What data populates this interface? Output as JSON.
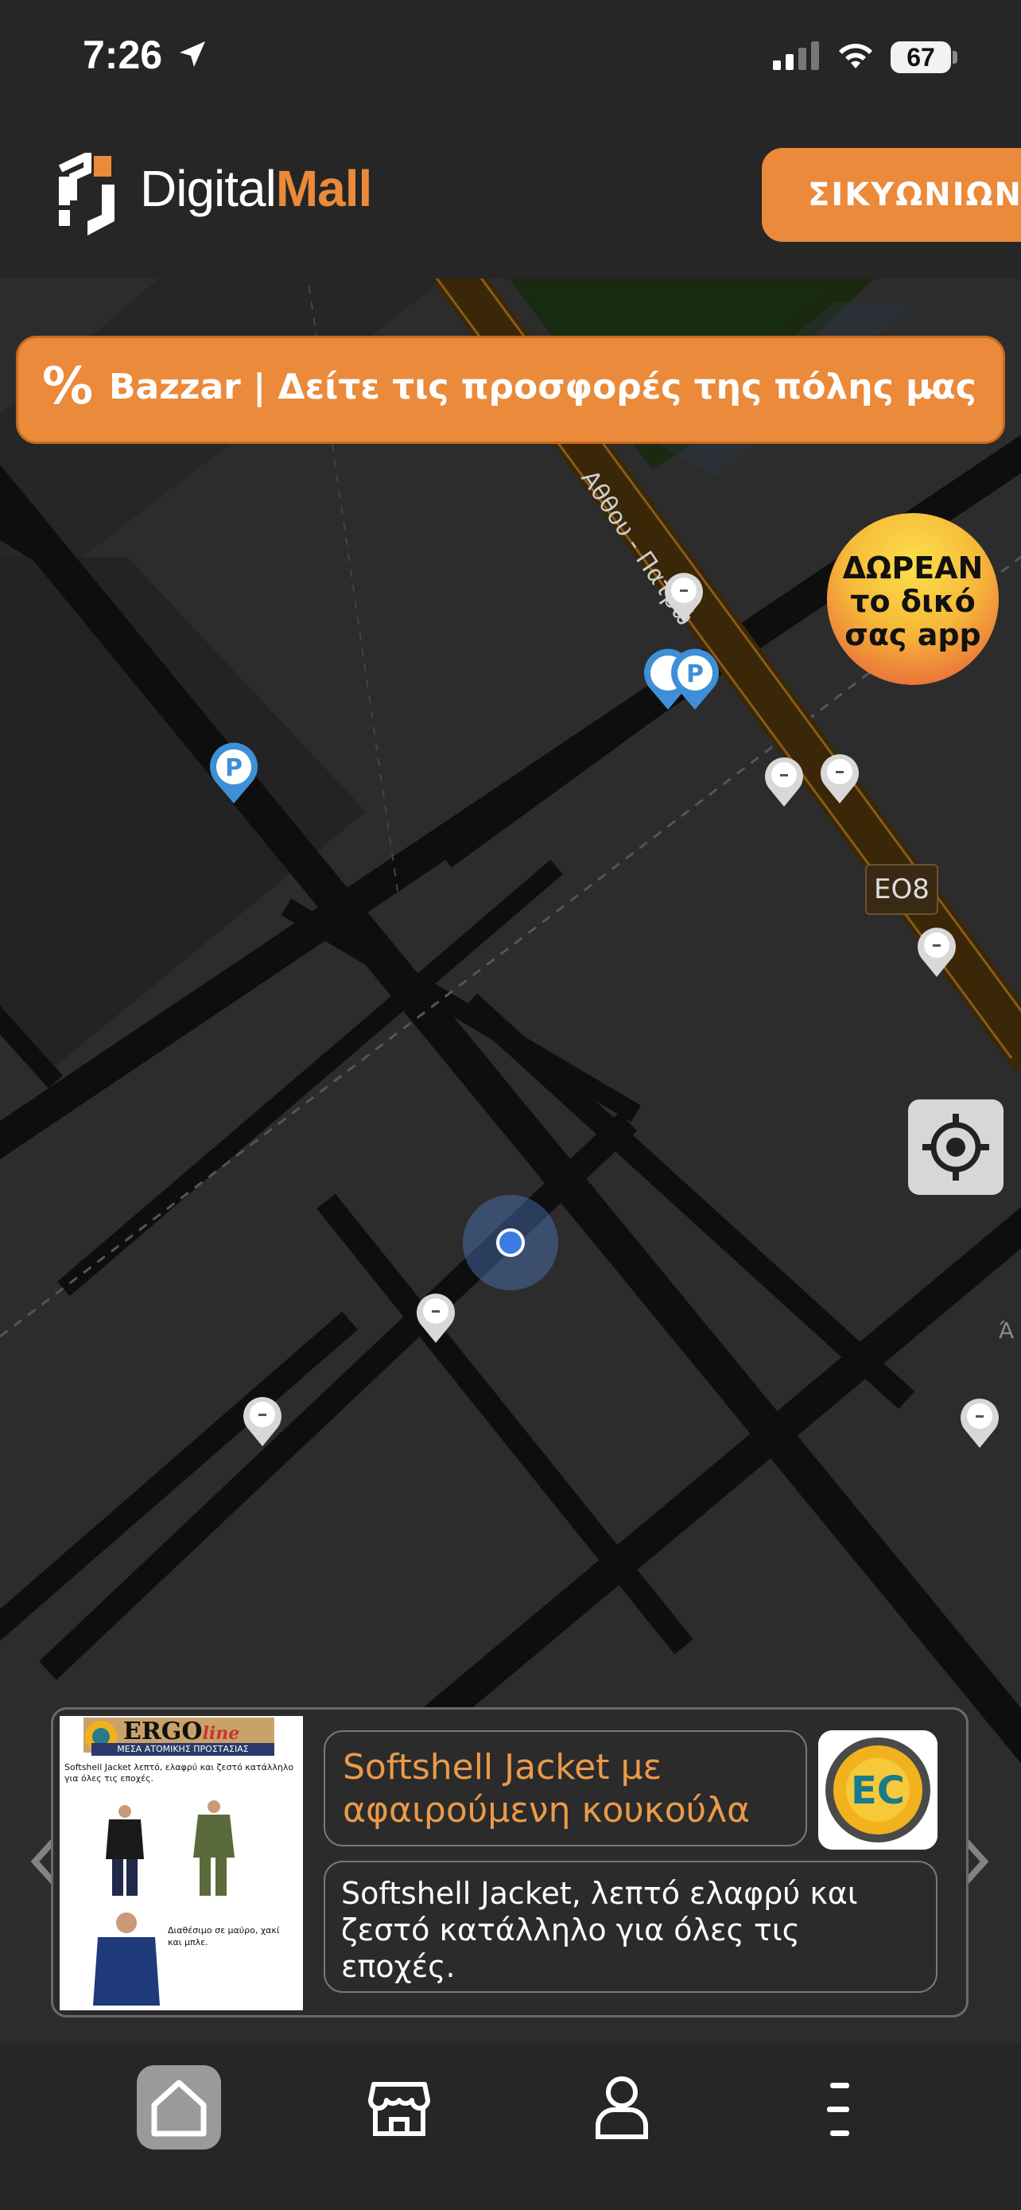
{
  "status_bar": {
    "time": "7:26",
    "battery": "67"
  },
  "header": {
    "logo_plain": "Digital",
    "logo_accent": "Mall",
    "city_button": "ΣΙΚΥΩΝΙΩΝ"
  },
  "promo_banner": {
    "icon": "%",
    "text": "Bazzar | Δείτε τις προσφορές της πόλης μας",
    "arrow": "▸"
  },
  "free_app_badge": {
    "line1": "ΔΩΡΕΑΝ",
    "line2": "το δικό",
    "line3": "σας app"
  },
  "map": {
    "street_label": "Αθθου - Πατρώ",
    "road_badge": "ΕΟ8",
    "edge_label": "Ά",
    "parking_letter": "P"
  },
  "product_card": {
    "title": "Softshell Jacket με αφαιρούμενη κουκούλα",
    "description": "Softshell Jacket, λεπτό ελαφρύ και ζεστό κατάλληλο για όλες τις εποχές.",
    "image": {
      "brand": "ERGO",
      "brand_suffix": "line",
      "subtitle": "ΜΕΣΑ ΑΤΟΜΙΚΗΣ ΠΡΟΣΤΑΣΙΑΣ",
      "caption": "Softshell Jacket λεπτό, ελαφρύ και ζεστό κατάλληλο για όλες τις εποχές.",
      "colors_note": "Διαθέσιμο σε μαύρο, χακί και μπλε."
    },
    "logo_text": "EC"
  },
  "bottom_nav": {
    "items": [
      "home-icon",
      "store-icon",
      "profile-icon",
      "menu-icon"
    ]
  },
  "colors": {
    "accent": "#ea8a3a",
    "background": "#262626",
    "map_road": "#0e0e0e",
    "location_dot": "#3d7be0"
  }
}
